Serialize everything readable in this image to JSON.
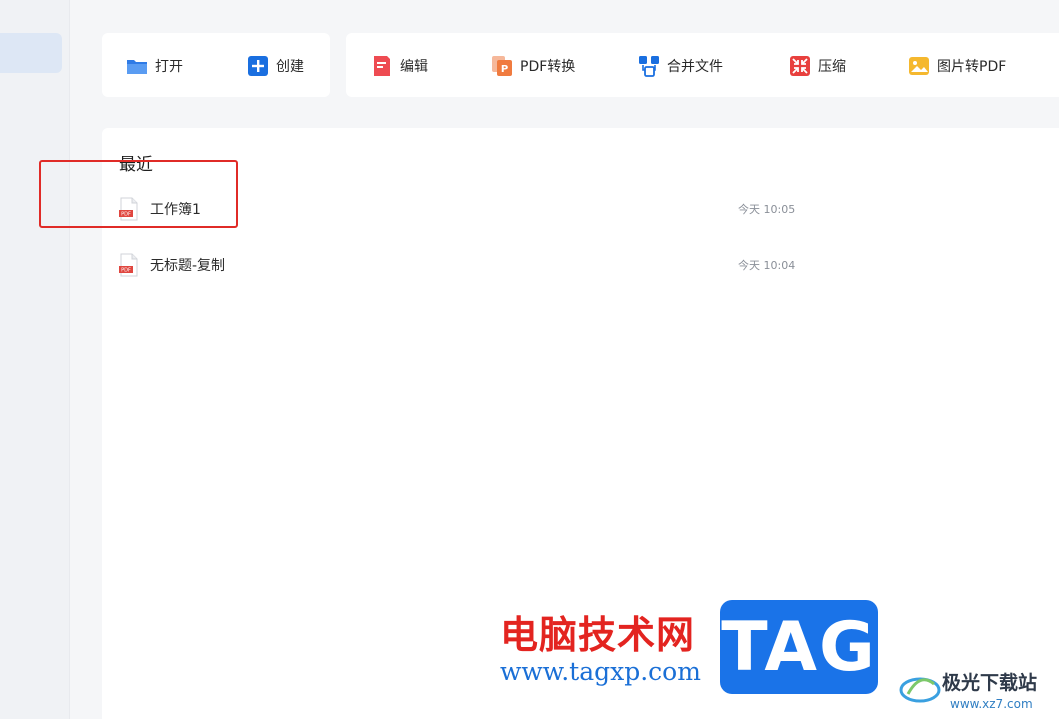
{
  "toolbar": {
    "open_label": "打开",
    "create_label": "创建",
    "edit_label": "编辑",
    "pdf_convert_label": "PDF转换",
    "merge_label": "合并文件",
    "compress_label": "压缩",
    "image_to_pdf_label": "图片转PDF"
  },
  "recent": {
    "title": "最近",
    "files": [
      {
        "name": "工作簿1",
        "time": "今天 10:05",
        "badge": "PDF"
      },
      {
        "name": "无标题-复制",
        "time": "今天 10:04",
        "badge": "PDF"
      }
    ]
  },
  "watermark": {
    "site_cn": "电脑技术网",
    "site_url": "www.tagxp.com",
    "tag_text": "TAG",
    "secondary_cn": "极光下载站",
    "secondary_url": "www.xz7.com"
  },
  "colors": {
    "accent_blue": "#1a73e8",
    "highlight_red": "#e02b27",
    "pdf_red": "#e0463f",
    "edit_red": "#ee4b52",
    "convert_orange": "#f07b3f",
    "compress_red": "#e8403e",
    "image_yellow": "#f5b82e"
  },
  "icons": [
    "folder-icon",
    "plus-icon",
    "edit-icon",
    "pdf-convert-icon",
    "merge-icon",
    "compress-icon",
    "image-icon",
    "pdf-file-icon"
  ]
}
